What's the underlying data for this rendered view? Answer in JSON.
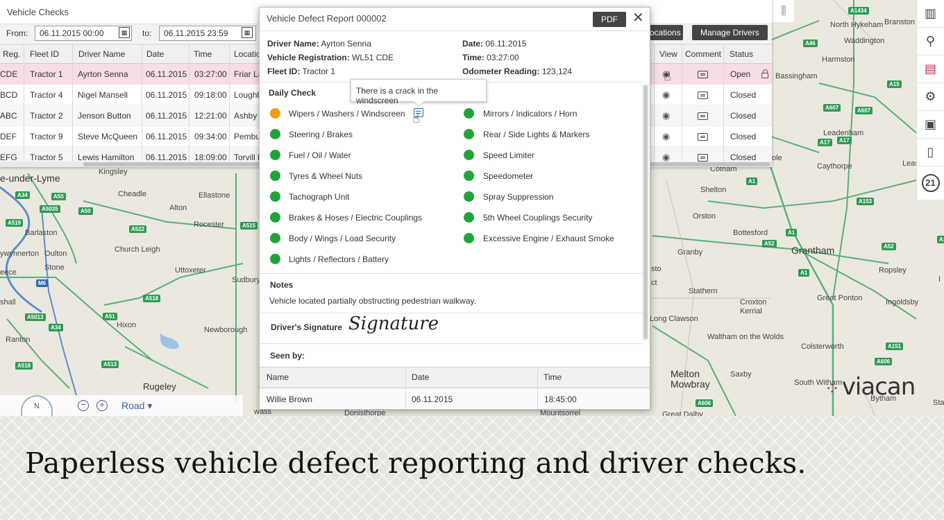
{
  "app": {
    "panel_title": "Vehicle Checks",
    "filters": {
      "from_label": "From:",
      "from_value": "06.11.2015  00:00",
      "to_label": "to:",
      "to_value": "06.11.2015  23:59"
    },
    "buttons": {
      "locations": "ocations",
      "manage_drivers": "Manage Drivers"
    },
    "columns": [
      "Reg.",
      "Fleet ID",
      "Driver Name",
      "Date",
      "Time",
      "Location",
      "View",
      "Comment",
      "Status"
    ],
    "rows": [
      {
        "reg": "CDE",
        "fleet": "Tractor 1",
        "driver": "Ayrton Senna",
        "date": "06.11.2015",
        "time": "03:27:00",
        "location": "Friar La",
        "status": "Open"
      },
      {
        "reg": "BCD",
        "fleet": "Tractor 4",
        "driver": "Nigel Mansell",
        "date": "06.11.2015",
        "time": "09:18:00",
        "location": "Loughb",
        "status": "Closed"
      },
      {
        "reg": "ABC",
        "fleet": "Tractor 2",
        "driver": "Jenson Button",
        "date": "06.11.2015",
        "time": "12:21:00",
        "location": "Ashby",
        "status": "Closed"
      },
      {
        "reg": "DEF",
        "fleet": "Tractor 9",
        "driver": "Steve McQueen",
        "date": "06.11.2015",
        "time": "09:34:00",
        "location": "Pembu",
        "status": "Closed"
      },
      {
        "reg": "EFG",
        "fleet": "Tractor 5",
        "driver": "Lewis Hamilton",
        "date": "06.11.2015",
        "time": "18:09:00",
        "location": "Torvill D",
        "status": "Closed"
      }
    ]
  },
  "modal": {
    "title": "Vehicle Defect Report 000002",
    "pdf_label": "PDF",
    "close_glyph": "✕",
    "driver_name_label": "Driver Name:",
    "driver_name": "Ayrton Senna",
    "vehicle_reg_label": "Vehicle Registration:",
    "vehicle_reg": "WL51 CDE",
    "fleet_id_label": "Fleet ID:",
    "fleet_id": "Tractor 1",
    "date_label": "Date:",
    "date": "06.11.2015",
    "time_label": "Time:",
    "time": "03:27:00",
    "odometer_label": "Odometer Reading:",
    "odometer": "123,124",
    "daily_check_title": "Daily Check",
    "tooltip": "There is a crack in the windscreen",
    "checks_left": [
      {
        "label": "Wipers / Washers / Windscreen",
        "status": "warning"
      },
      {
        "label": "Steering / Brakes",
        "status": "ok"
      },
      {
        "label": "Fuel / Oil / Water",
        "status": "ok"
      },
      {
        "label": "Tyres & Wheel Nuts",
        "status": "ok"
      },
      {
        "label": "Tachograph Unit",
        "status": "ok"
      },
      {
        "label": "Brakes & Hoses / Electric Couplings",
        "status": "ok"
      },
      {
        "label": "Body / Wings / Load Security",
        "status": "ok"
      },
      {
        "label": "Lights / Reflectors / Battery",
        "status": "ok"
      }
    ],
    "checks_right": [
      {
        "label": "Mirrors / Indicators / Horn",
        "status": "ok"
      },
      {
        "label": "Rear / Side Lights & Markers",
        "status": "ok"
      },
      {
        "label": "Speed Limiter",
        "status": "ok"
      },
      {
        "label": "Speedometer",
        "status": "ok"
      },
      {
        "label": "Spray Suppression",
        "status": "ok"
      },
      {
        "label": "5th Wheel Couplings Security",
        "status": "ok"
      },
      {
        "label": "Excessive Engine / Exhaust Smoke",
        "status": "ok"
      }
    ],
    "notes_title": "Notes",
    "notes": "Vehicle located partially obstructing pedestrian walkway.",
    "signature_label": "Driver's Signature",
    "signature": "Signature",
    "seen_by_title": "Seen by:",
    "seen_by_columns": [
      "Name",
      "Date",
      "Time"
    ],
    "seen_by_row": {
      "name": "Willie Brown",
      "date": "06.11.2015",
      "time": "18:45:00"
    }
  },
  "map": {
    "places": {
      "newcastle": "e-under-Lyme",
      "cheadle": "Cheadle",
      "ellastone": "Ellastone",
      "alton": "Alton",
      "rocester": "Rocester",
      "barlaston": "Barlaston",
      "oulton": "Oulton",
      "stone": "Stone",
      "church_leigh": "Church Leigh",
      "uttoxeter": "Uttoxeter",
      "sudbury": "Sudbury",
      "hixon": "Hixon",
      "newborough": "Newborough",
      "rugeley": "Rugeley",
      "ranton": "Ranton",
      "shall": "shall",
      "eece": "eece",
      "ywynnerton": "ywynnerton",
      "kingsley": "Kingsley",
      "wass": "wass",
      "north_hykeham": "North Hykeham",
      "waddington": "Waddington",
      "branston": "Branston",
      "harmston": "Harmston",
      "bassingham": "Bassingham",
      "leadenham": "Leadenham",
      "caythorpe": "Caythorpe",
      "cotham": "Cotham",
      "shelton": "Shelton",
      "orston": "Orston",
      "bottesford": "Bottesford",
      "grantham": "Grantham",
      "ropsley": "Ropsley",
      "granby": "Granby",
      "stathern": "Stathern",
      "croxton_kerrial": "Croxton\nKerrial",
      "great_ponton": "Great Ponton",
      "ingoldsby": "Ingoldsby",
      "long_clawson": "Long Clawson",
      "waltham": "Waltham on the Wolds",
      "colsterworth": "Colsterworth",
      "saxby": "Saxby",
      "melton": "Melton\nMowbray",
      "south_witham": "South Witham",
      "bytham": "Bytham",
      "sto": "sto",
      "leas": "Leas",
      "ole": "ole",
      "donisthorpe": "Donisthorpe",
      "mountsorrel": "Mountsorrel",
      "great_dalby": "Great Dalby",
      "stanton": "Stanton",
      "ct": "ct",
      "i": "I"
    },
    "roads": [
      "A34",
      "A50",
      "A5035",
      "A50",
      "A519",
      "A522",
      "A515",
      "M6",
      "A518",
      "A51",
      "A34",
      "A5013",
      "A518",
      "A513",
      "A1434",
      "A46",
      "A607",
      "A15",
      "A607",
      "A17",
      "A17",
      "A1",
      "A153",
      "A1",
      "A52",
      "A52",
      "A1",
      "A1",
      "A151",
      "A606",
      "A606"
    ],
    "compass": "N",
    "zoom_out": "−",
    "zoom_in": "+",
    "road_mode": "Road ▾"
  },
  "toolbar": {
    "day_badge": "21"
  },
  "logo": "viacan",
  "tagline": "Paperless vehicle defect reporting and driver checks."
}
